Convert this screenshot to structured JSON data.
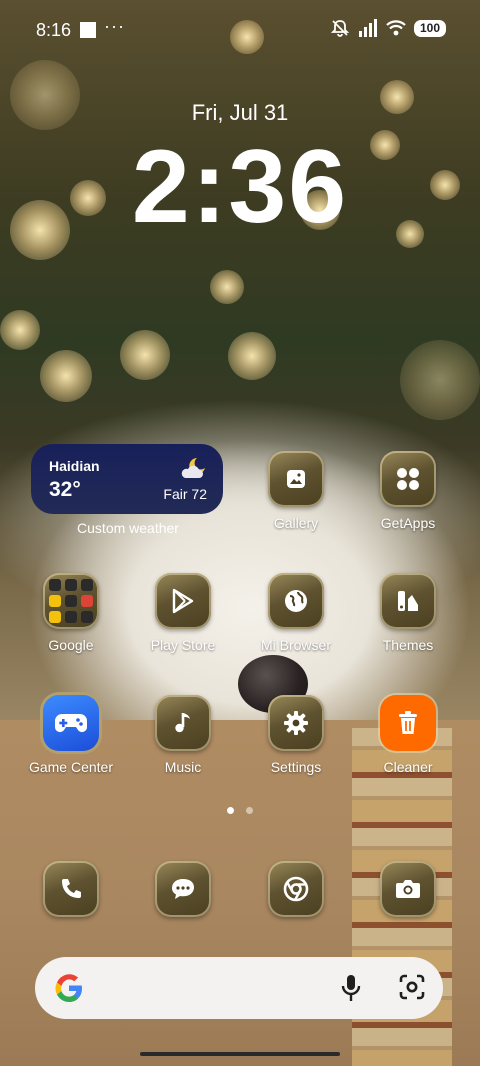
{
  "status_bar": {
    "time": "8:16",
    "overflow": "···",
    "battery": "100"
  },
  "lock": {
    "date": "Fri, Jul 31",
    "time": "2:36"
  },
  "weather": {
    "city": "Haidian",
    "temp": "32°",
    "condition": "Fair 72",
    "label": "Custom weather"
  },
  "apps": {
    "gallery": "Gallery",
    "getapps": "GetApps",
    "google": "Google",
    "playstore": "Play Store",
    "mibrowser": "Mi Browser",
    "themes": "Themes",
    "gamecenter": "Game Center",
    "music": "Music",
    "settings": "Settings",
    "cleaner": "Cleaner"
  },
  "icons": {
    "dock": [
      "phone-icon",
      "messages-icon",
      "chrome-icon",
      "camera-icon"
    ]
  },
  "colors": {
    "cleaner": "#ff6a00",
    "weather_bg": "#1c2458",
    "tile": "#5e5230"
  }
}
